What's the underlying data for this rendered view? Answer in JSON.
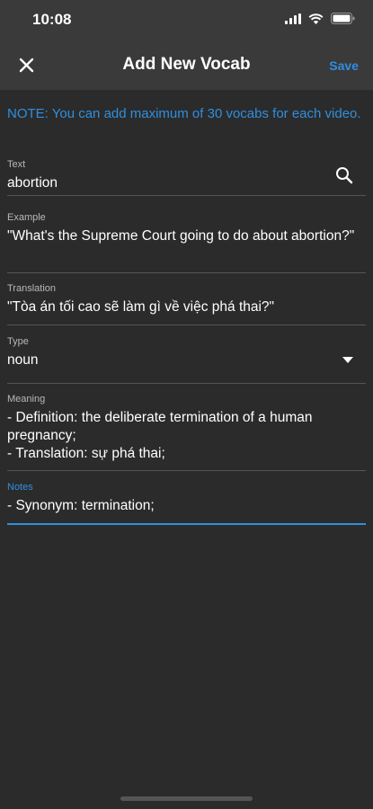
{
  "status_bar": {
    "time": "10:08"
  },
  "nav": {
    "title": "Add New Vocab",
    "save_label": "Save"
  },
  "note": "NOTE: You can add maximum of 30 vocabs for each video.",
  "fields": {
    "text": {
      "label": "Text",
      "value": "abortion"
    },
    "example": {
      "label": "Example",
      "value": "\"What's the Supreme Court going to do about abortion?\""
    },
    "translation": {
      "label": "Translation",
      "value": "\"Tòa án tối cao sẽ làm gì về việc phá thai?\""
    },
    "type": {
      "label": "Type",
      "value": "noun"
    },
    "meaning": {
      "label": "Meaning",
      "value": "- Definition: the deliberate termination of a human pregnancy;\n- Translation: sự phá thai;"
    },
    "notes": {
      "label": "Notes",
      "value": "- Synonym: termination;"
    }
  },
  "colors": {
    "accent": "#2f8fe0",
    "background": "#2b2b2b",
    "header": "#3a3a3a"
  },
  "icons": [
    "close-icon",
    "search-icon",
    "dropdown-arrow-icon",
    "signal-icon",
    "wifi-icon",
    "battery-icon"
  ]
}
